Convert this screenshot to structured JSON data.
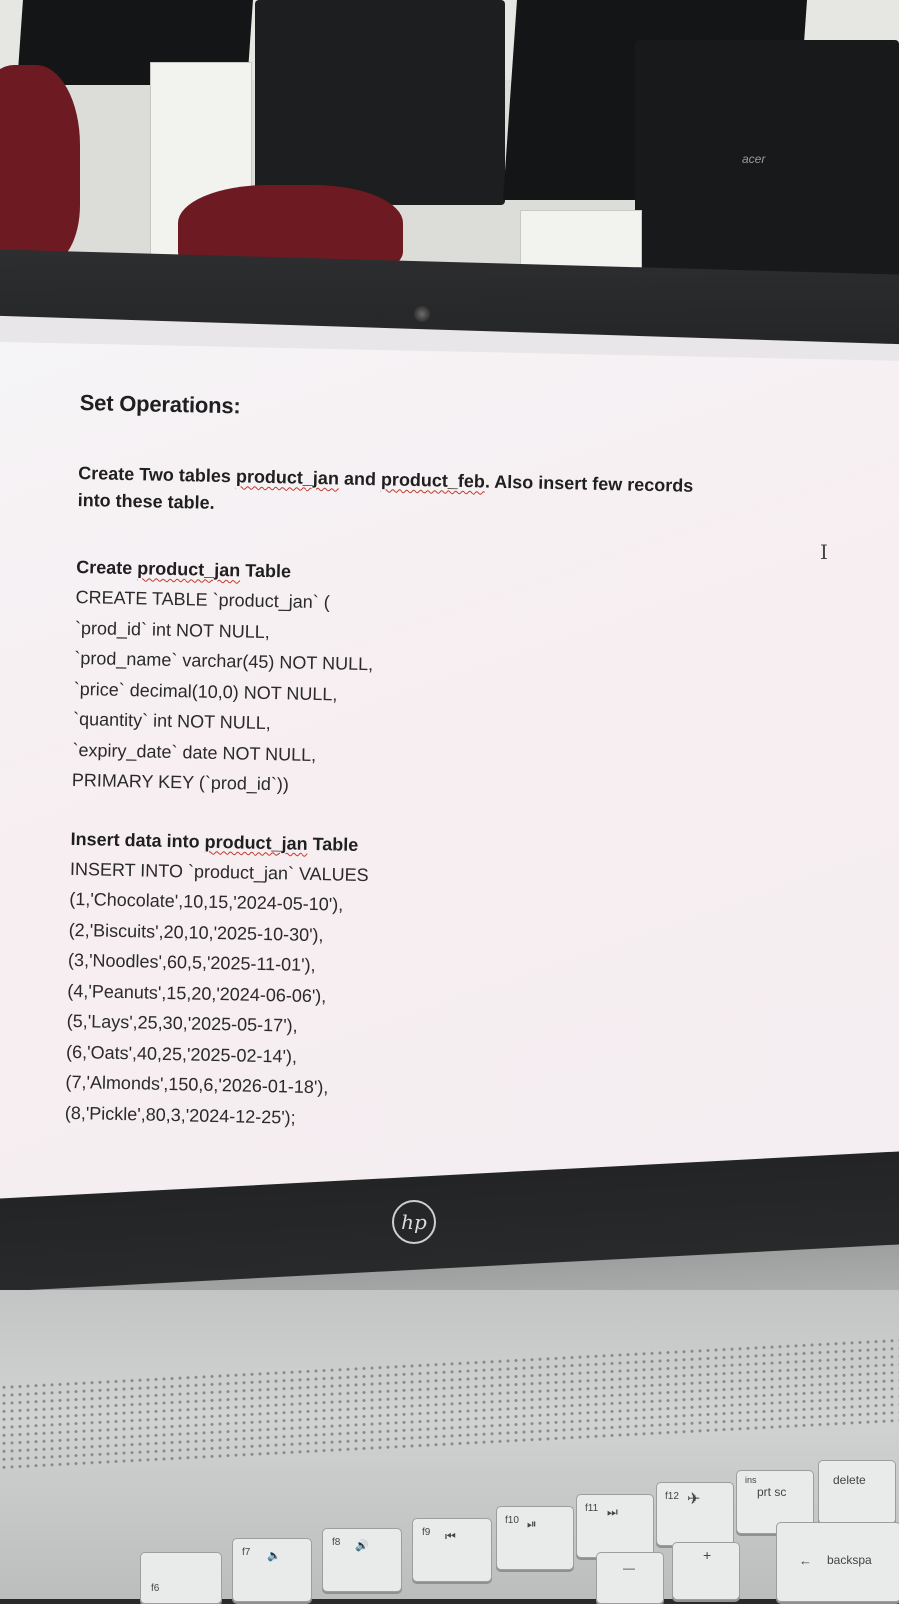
{
  "document": {
    "heading": "Set Operations:",
    "intro_line1_pre": "Create Two tables ",
    "intro_table1": "product_jan",
    "intro_mid": " and ",
    "intro_table2": "product_feb",
    "intro_line1_post": ". Also insert few records",
    "intro_line2": "into these table.",
    "create_title_pre": "Create ",
    "create_title_table": "product_jan",
    "create_title_post": " Table",
    "create_lines": [
      "CREATE TABLE `product_jan` (",
      "`prod_id` int NOT NULL,",
      "`prod_name` varchar(45) NOT NULL,",
      "`price` decimal(10,0) NOT NULL,",
      "`quantity` int NOT NULL,",
      "`expiry_date` date NOT NULL,",
      "PRIMARY KEY (`prod_id`))"
    ],
    "insert_title_pre": "Insert data into ",
    "insert_title_table": "product_jan",
    "insert_title_post": " Table",
    "insert_lines": [
      "INSERT INTO `product_jan` VALUES",
      "(1,'Chocolate',10,15,'2024-05-10'),",
      "(2,'Biscuits',20,10,'2025-10-30'),",
      "(3,'Noodles',60,5,'2025-11-01'),",
      "(4,'Peanuts',15,20,'2024-06-06'),",
      "(5,'Lays',25,30,'2025-05-17'),",
      "(6,'Oats',40,25,'2025-02-14'),",
      "(7,'Almonds',150,6,'2026-01-18'),",
      "(8,'Pickle',80,3,'2024-12-25');"
    ]
  },
  "cursor_glyph": "I",
  "laptop_logo": "hp",
  "monitor_logo": "acer",
  "keys": {
    "f6": "f6",
    "f7": "f7",
    "f8": "f8",
    "f9": "f9",
    "f10": "f10",
    "f11": "f11",
    "f12": "f12",
    "ins": "ins",
    "prt_sc": "prt sc",
    "delete": "delete",
    "backspace": "backspa",
    "minus": "—",
    "plus": "+",
    "f9_glyph": "⏮",
    "f10_glyph": "⏯",
    "f11_glyph": "⏭",
    "f12_glyph": "✈",
    "f7_glyph": "🔈",
    "f8_glyph": "🔊",
    "backspace_glyph": "←"
  },
  "colors": {
    "squiggle": "#c0392b",
    "chair": "#6e1a22",
    "screen": "#f6f1f3"
  }
}
